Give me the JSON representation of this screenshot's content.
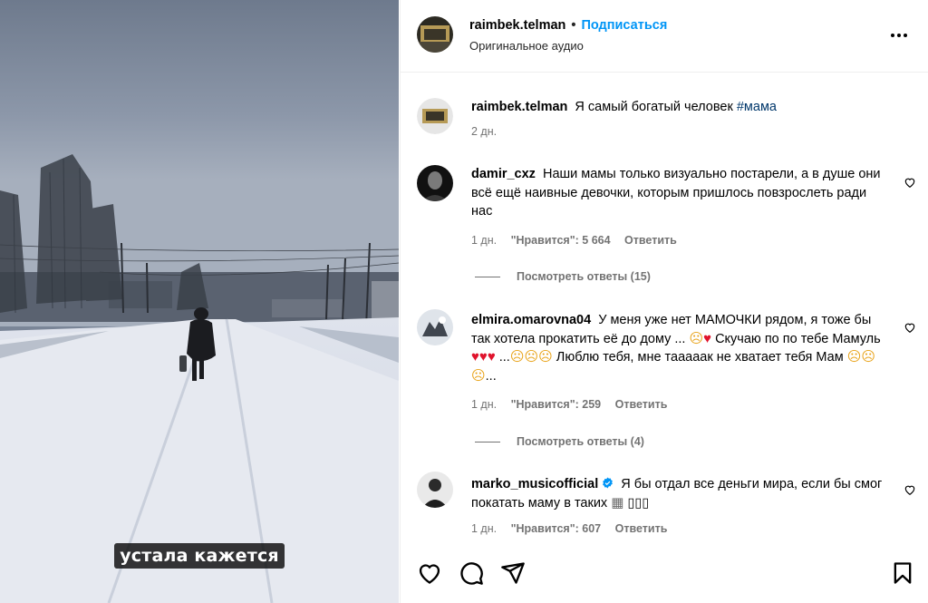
{
  "video": {
    "subtitle": "устала кажется"
  },
  "header": {
    "username": "raimbek.telman",
    "separator": "•",
    "follow_label": "Подписаться",
    "audio_label": "Оригинальное аудио"
  },
  "caption": {
    "username": "raimbek.telman",
    "text": "Я самый богатый человек",
    "hashtag": "#мама",
    "time": "2 дн."
  },
  "comments": [
    {
      "username": "damir_cxz",
      "text": "Наши мамы только визуально постарели, а в душе они всё ещё наивные девочки, которым пришлось повзрослеть ради нас",
      "time": "1 дн.",
      "likes": "\"Нравится\": 5 664",
      "reply": "Ответить",
      "view_replies": "Посмотреть ответы (15)"
    },
    {
      "username": "elmira.omarovna04",
      "text_1": "У меня уже нет МАМОЧКИ рядом, я тоже бы так хотела прокатить её до дому ...",
      "text_2": "Скучаю по по тебе Мамуль",
      "text_3": "...",
      "text_4": "Люблю тебя, мне тааааак не хватает тебя Мам",
      "text_5": "...",
      "time": "1 дн.",
      "likes": "\"Нравится\": 259",
      "reply": "Ответить",
      "view_replies": "Посмотреть ответы (4)"
    },
    {
      "username": "marko_musicofficial",
      "text": "Я бы отдал все деньги мира, если бы смог покатать маму в таких",
      "tail": "▯▯▯",
      "time": "1 дн.",
      "likes": "\"Нравится\": 607",
      "reply": "Ответить"
    }
  ],
  "icons": {
    "heart": "heart-icon",
    "comment": "comment-icon",
    "share": "share-icon",
    "save": "bookmark-icon",
    "more": "more-icon",
    "verified": "verified-badge-icon"
  },
  "colors": {
    "link_blue": "#0095f6",
    "hashtag": "#00376b",
    "secondary_text": "#737373",
    "verified": "#0095f6"
  }
}
